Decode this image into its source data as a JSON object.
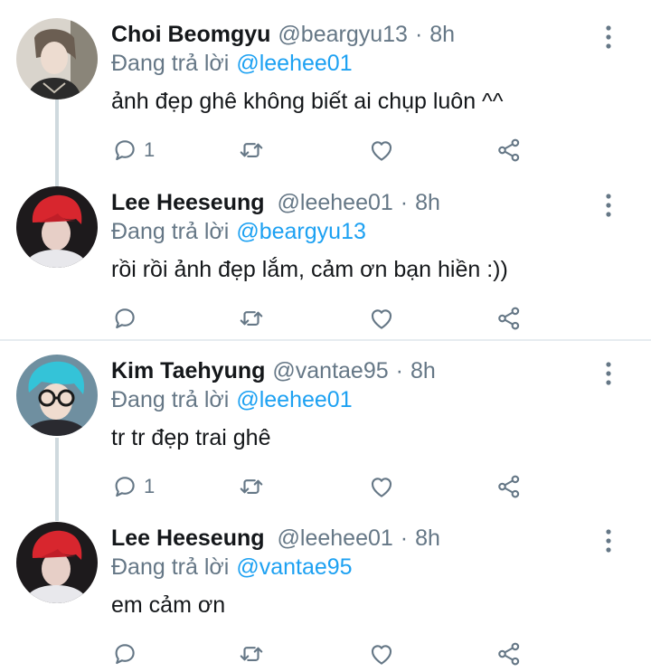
{
  "colors": {
    "accent": "#1da1f2",
    "secondary_text": "#657786",
    "primary_text": "#14171a",
    "thread_line": "#cfd9de",
    "divider": "#e6ecf0"
  },
  "icons": {
    "reply": "reply-icon",
    "retweet": "retweet-icon",
    "like": "heart-icon",
    "share": "share-icon",
    "more": "more-vertical-icon"
  },
  "tweets": [
    {
      "name": "Choi Beomgyu",
      "handle": "@beargyu13",
      "separator": "·",
      "time": "8h",
      "reply_prefix": "Đang trả lời",
      "reply_to": "@leehee01",
      "text": "ảnh đẹp ghê không biết ai chụp luôn ^^",
      "reply_count": "1"
    },
    {
      "name": "Lee Heeseung",
      "handle": "@leehee01",
      "separator": "·",
      "time": "8h",
      "reply_prefix": "Đang trả lời",
      "reply_to": "@beargyu13",
      "text": "rồi rồi ảnh đẹp lắm, cảm ơn bạn hiền :))",
      "reply_count": ""
    },
    {
      "name": "Kim Taehyung",
      "handle": "@vantae95",
      "separator": "·",
      "time": "8h",
      "reply_prefix": "Đang trả lời",
      "reply_to": "@leehee01",
      "text": "tr tr đẹp trai ghê",
      "reply_count": "1"
    },
    {
      "name": "Lee Heeseung",
      "handle": "@leehee01",
      "separator": "·",
      "time": "8h",
      "reply_prefix": "Đang trả lời",
      "reply_to": "@vantae95",
      "text": "em cảm ơn",
      "reply_count": ""
    }
  ]
}
